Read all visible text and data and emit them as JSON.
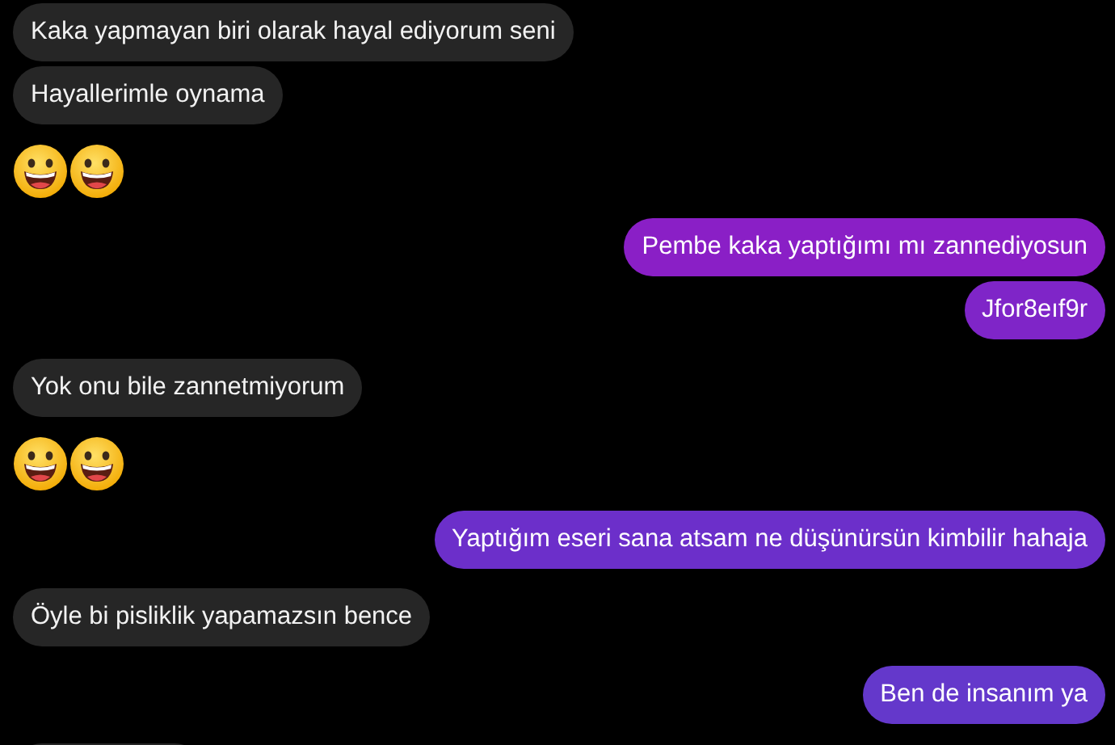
{
  "messages": [
    {
      "kind": "received",
      "text": "Kaka yapmayan biri olarak hayal ediyorum seni"
    },
    {
      "kind": "received",
      "text": "Hayallerimle oynama"
    },
    {
      "kind": "emojis",
      "icons": [
        {
          "kind": "grin"
        },
        {
          "kind": "grin"
        }
      ]
    },
    {
      "kind": "sent",
      "text": "Pembe kaka yaptığımı mı zannediyosun",
      "color": "#8a1fc6"
    },
    {
      "kind": "sent",
      "text": "Jfor8eıf9r",
      "color": "#7f25c8"
    },
    {
      "kind": "received",
      "text": "Yok onu bile zannetmiyorum"
    },
    {
      "kind": "emojis",
      "icons": [
        {
          "kind": "grin"
        },
        {
          "kind": "grin"
        }
      ]
    },
    {
      "kind": "sent",
      "text": "Yaptığım eseri sana atsam ne düşünürsün kimbilir hahaja",
      "color": "#6c2fca"
    },
    {
      "kind": "received",
      "text": "Öyle bi pisliklik yapamazsın bence"
    },
    {
      "kind": "sent",
      "text": "Ben de insanım ya",
      "color": "#6438cb"
    },
    {
      "kind": "cut_off"
    }
  ]
}
